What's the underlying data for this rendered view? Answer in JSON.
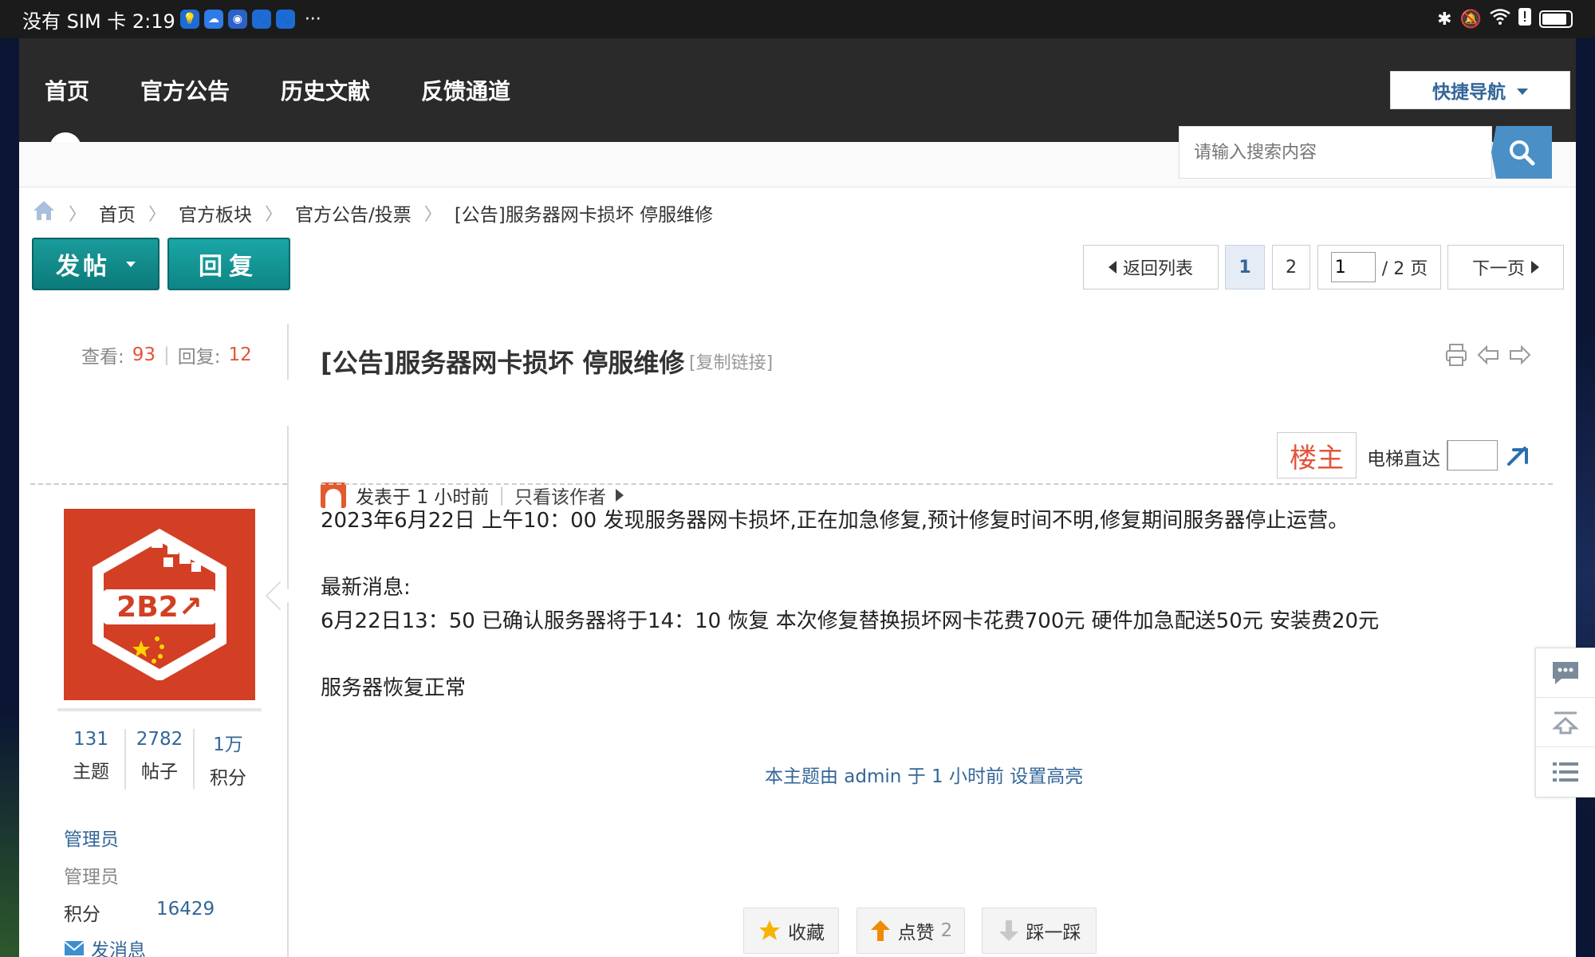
{
  "statusbar": {
    "carrier_time": "没有 SIM 卡 2:19",
    "more": "···"
  },
  "nav": {
    "items": [
      "首页",
      "官方公告",
      "历史文献",
      "反馈通道"
    ],
    "quicknav_label": "快捷导航"
  },
  "search": {
    "placeholder": "请输入搜索内容"
  },
  "breadcrumb": [
    "首页",
    "官方板块",
    "官方公告/投票",
    "[公告]服务器网卡损坏 停服维修"
  ],
  "toolbar": {
    "post_label": "发帖",
    "reply_label": "回复"
  },
  "pager": {
    "back_label": "返回列表",
    "page1": "1",
    "page2": "2",
    "current_value": "1",
    "total_label": "/ 2 页",
    "next_label": "下一页"
  },
  "thread": {
    "views_label": "查看:",
    "views": "93",
    "replies_label": "回复:",
    "replies": "12",
    "title": "[公告]服务器网卡损坏 停服维修",
    "copy_link": "[复制链接]"
  },
  "post": {
    "posted_at": "发表于 1 小时前",
    "only_author": "只看该作者",
    "floor_label": "楼主",
    "elevator_label": "电梯直达",
    "lines": [
      "2023年6月22日 上午10：00 发现服务器网卡损坏,正在加急修复,预计修复时间不明,修复期间服务器停止运营。",
      "最新消息:",
      "6月22日13：50 已确认服务器将于14：10 恢复 本次修复替换损坏网卡花费700元 硬件加急配送50元 安装费20元",
      "服务器恢复正常"
    ],
    "highlight_note": "本主题由 admin 于 1 小时前 设置高亮"
  },
  "author": {
    "avatar_text": "2B2↗",
    "stats": [
      {
        "value": "131",
        "label": "主题"
      },
      {
        "value": "2782",
        "label": "帖子"
      },
      {
        "value": "1万",
        "label": "积分"
      }
    ],
    "group": "管理员",
    "role": "管理员",
    "score_label": "积分",
    "score_value": "16429",
    "send_message": "发消息"
  },
  "actions": {
    "favorite_label": "收藏",
    "like_label": "点赞",
    "like_count": "2",
    "dislike_label": "踩一踩"
  },
  "colors": {
    "accent": "#336699",
    "highlight": "#e4543a",
    "button_teal": "#0e8585",
    "navbar": "#2a2a2a"
  }
}
